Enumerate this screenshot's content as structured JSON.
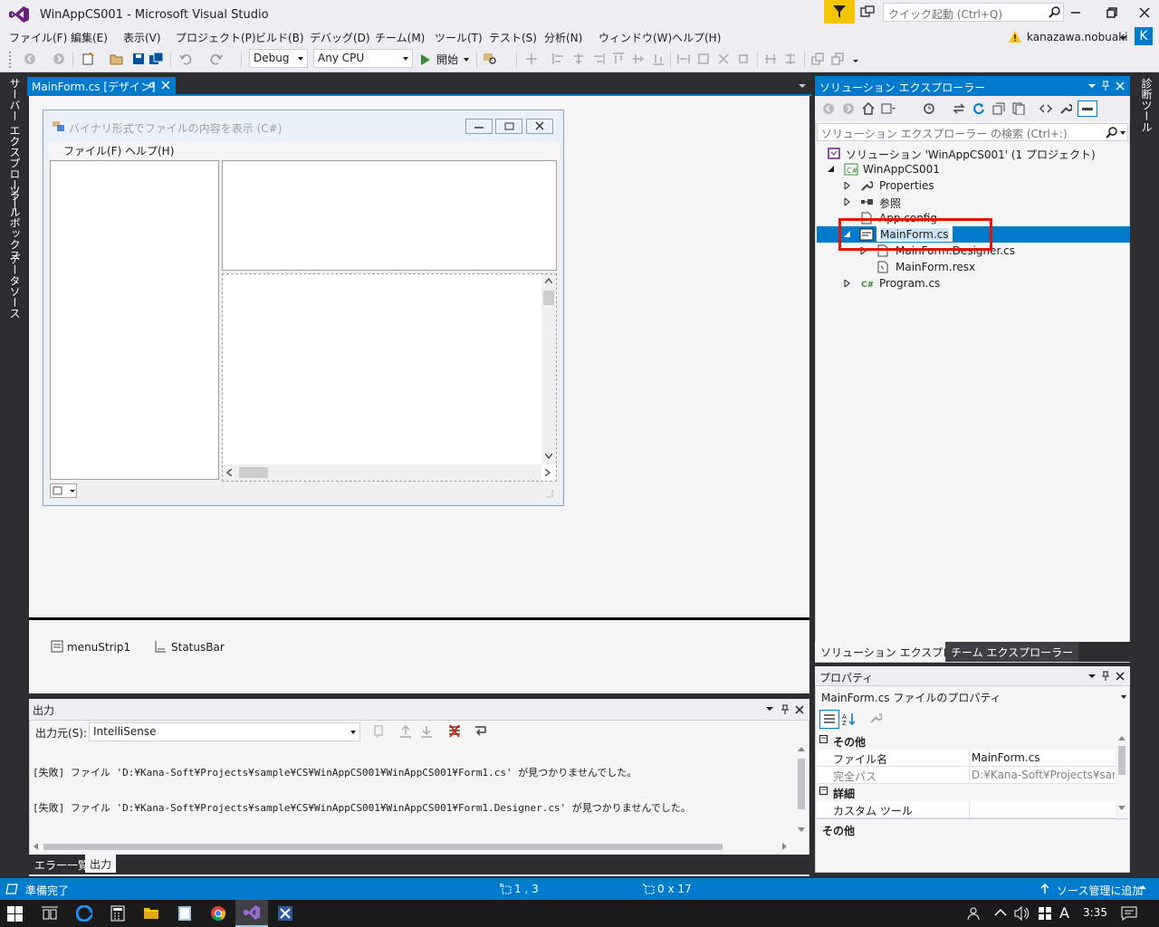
{
  "window": {
    "title": "WinAppCS001 - Microsoft Visual Studio",
    "quick_launch_placeholder": "クイック起動 (Ctrl+Q)",
    "user_name": "kanazawa.nobuaki",
    "user_initial": "K"
  },
  "menu": [
    "ファイル(F)",
    "編集(E)",
    "表示(V)",
    "プロジェクト(P)",
    "ビルド(B)",
    "デバッグ(D)",
    "チーム(M)",
    "ツール(T)",
    "テスト(S)",
    "分析(N)",
    "ウィンドウ(W)",
    "ヘルプ(H)"
  ],
  "toolbar": {
    "config": "Debug",
    "platform": "Any CPU",
    "start_label": "開始"
  },
  "left_rail": [
    "サーバー エクスプローラー",
    "ツールボックス",
    "データソース"
  ],
  "right_rail": [
    "診断ツール"
  ],
  "document_tab": {
    "label": "MainForm.cs [デザイン]"
  },
  "designer": {
    "form_title": "バイナリ形式でファイルの内容を表示 (C#)",
    "form_menu": [
      "ファイル(F)",
      "ヘルプ(H)"
    ],
    "tray_items": [
      "menuStrip1",
      "StatusBar"
    ]
  },
  "output": {
    "title": "出力",
    "source_label": "出力元(S):",
    "source_value": "IntelliSense",
    "lines": [
      "[失敗] ファイル 'D:¥Kana-Soft¥Projects¥sample¥CS¥WinAppCS001¥WinAppCS001¥Form1.cs' が見つかりませんでした。",
      "[失敗] ファイル 'D:¥Kana-Soft¥Projects¥sample¥CS¥WinAppCS001¥WinAppCS001¥Form1.Designer.cs' が見つかりませんでした。"
    ],
    "tabs": [
      "エラー一覧",
      "出力"
    ]
  },
  "solution_explorer": {
    "title": "ソリューション エクスプローラー",
    "search_placeholder": "ソリューション エクスプローラー の検索 (Ctrl+:)",
    "tree": {
      "solution": "ソリューション 'WinAppCS001' (1 プロジェクト)",
      "project": "WinAppCS001",
      "properties": "Properties",
      "references": "参照",
      "app_config": "App.config",
      "mainform": "MainForm.cs",
      "mainform_designer": "MainForm.Designer.cs",
      "mainform_resx": "MainForm.resx",
      "program": "Program.cs"
    },
    "tabs": [
      "ソリューション エクスプローラー",
      "チーム エクスプローラー"
    ]
  },
  "properties": {
    "title": "プロパティ",
    "selected": "MainForm.cs  ファイルのプロパティ",
    "categories": [
      "その他",
      "詳細"
    ],
    "rows": [
      {
        "name": "ファイル名",
        "value": "MainForm.cs"
      },
      {
        "name": "完全パス",
        "value": "D:¥Kana-Soft¥Projects¥sample"
      },
      {
        "name": "カスタム ツール",
        "value": ""
      }
    ],
    "description": "その他"
  },
  "status": {
    "ready": "準備完了",
    "position": "1 , 3",
    "size": "0 x 17",
    "source_control": "ソース管理に追加"
  },
  "taskbar": {
    "time": "3:35",
    "ime": "A"
  },
  "colors": {
    "accent": "#007acc",
    "highlight_box": "#e51400",
    "vs_purple": "#68217a"
  }
}
